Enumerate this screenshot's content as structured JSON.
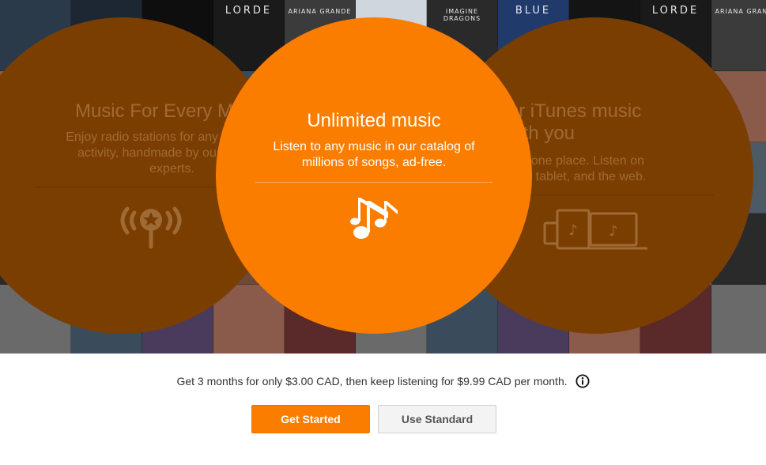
{
  "colors": {
    "accent": "#fb7d00",
    "side_circle": "#7a3f00",
    "side_text": "#a06a36"
  },
  "album_tiles": [
    {
      "text": "",
      "color": "#2b3a4a"
    },
    {
      "text": "",
      "color": "#1c2733"
    },
    {
      "text": "",
      "color": "#0e0e0e"
    },
    {
      "text": "LORDE",
      "color": "#1a1a1a"
    },
    {
      "text": "ARIANA GRANDE",
      "color": "#3b3b3b"
    },
    {
      "text": "",
      "color": "#cfd6dd"
    },
    {
      "text": "IMAGINE DRAGONS",
      "color": "#2a2a2a"
    },
    {
      "text": "BLUE",
      "color": "#1f3a6b"
    },
    {
      "text": "",
      "color": "#141414"
    },
    {
      "text": "LORDE",
      "color": "#1a1a1a"
    },
    {
      "text": "ARIANA GRANDE",
      "color": "#3b3b3b"
    }
  ],
  "cards": [
    {
      "title": "Music For Every Mood",
      "desc_line1": "Enjoy radio stations for any mood and",
      "desc_line2": "activity, handmade by our team of",
      "desc_line3": "experts.",
      "icon": "radio-station-icon"
    },
    {
      "title": "Unlimited music",
      "desc_line1": "Listen to any music in our catalog of",
      "desc_line2": "millions of songs, ad-free.",
      "icon": "music-notes-icon"
    },
    {
      "title_line1": "Bring your iTunes music",
      "title_line2": "with you",
      "desc_line1": "All your music in one place. Listen on",
      "desc_line2": "your smartphone, tablet, and the web.",
      "icon": "devices-icon"
    }
  ],
  "promo": {
    "text": "Get 3 months for only $3.00 CAD, then keep listening for $9.99 CAD per month.",
    "icon": "info-icon"
  },
  "buttons": {
    "primary": "Get Started",
    "secondary": "Use Standard"
  }
}
